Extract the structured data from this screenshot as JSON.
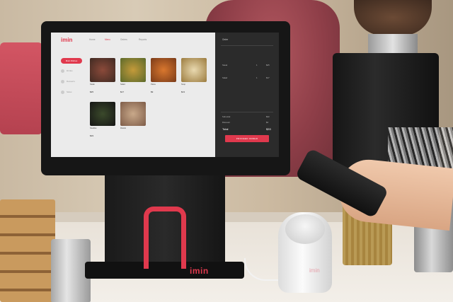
{
  "screen": {
    "app_logo": "imin",
    "nav": [
      "Home",
      "Menu",
      "Orders",
      "Reports"
    ],
    "sidebar": {
      "active": "Main Dishes",
      "items": [
        "Drinks",
        "Desserts",
        "Sides"
      ]
    },
    "menu_items": [
      {
        "name": "Steak",
        "price": "$25"
      },
      {
        "name": "Salad",
        "price": "$17"
      },
      {
        "name": "Pasta",
        "price": "$9"
      },
      {
        "name": "Soup",
        "price": "$13"
      },
      {
        "name": "Noodles",
        "price": "$19"
      },
      {
        "name": "Risotto",
        "price": ""
      }
    ],
    "order": {
      "title": "Order",
      "lines": [
        {
          "name": "Steak",
          "qty": "1",
          "price": "$25"
        },
        {
          "name": "Salad",
          "qty": "1",
          "price": "$17"
        }
      ],
      "subtotal_label": "Sub-total",
      "subtotal": "$42",
      "discount_label": "Discount",
      "discount": "$4",
      "total_label": "Total",
      "total": "$33",
      "proceed": "PROCEED ORDER"
    }
  },
  "device": {
    "base_logo": "imin",
    "reader_logo": "imin"
  },
  "colors": {
    "accent": "#e0394d",
    "panel": "#2b2b2b"
  }
}
